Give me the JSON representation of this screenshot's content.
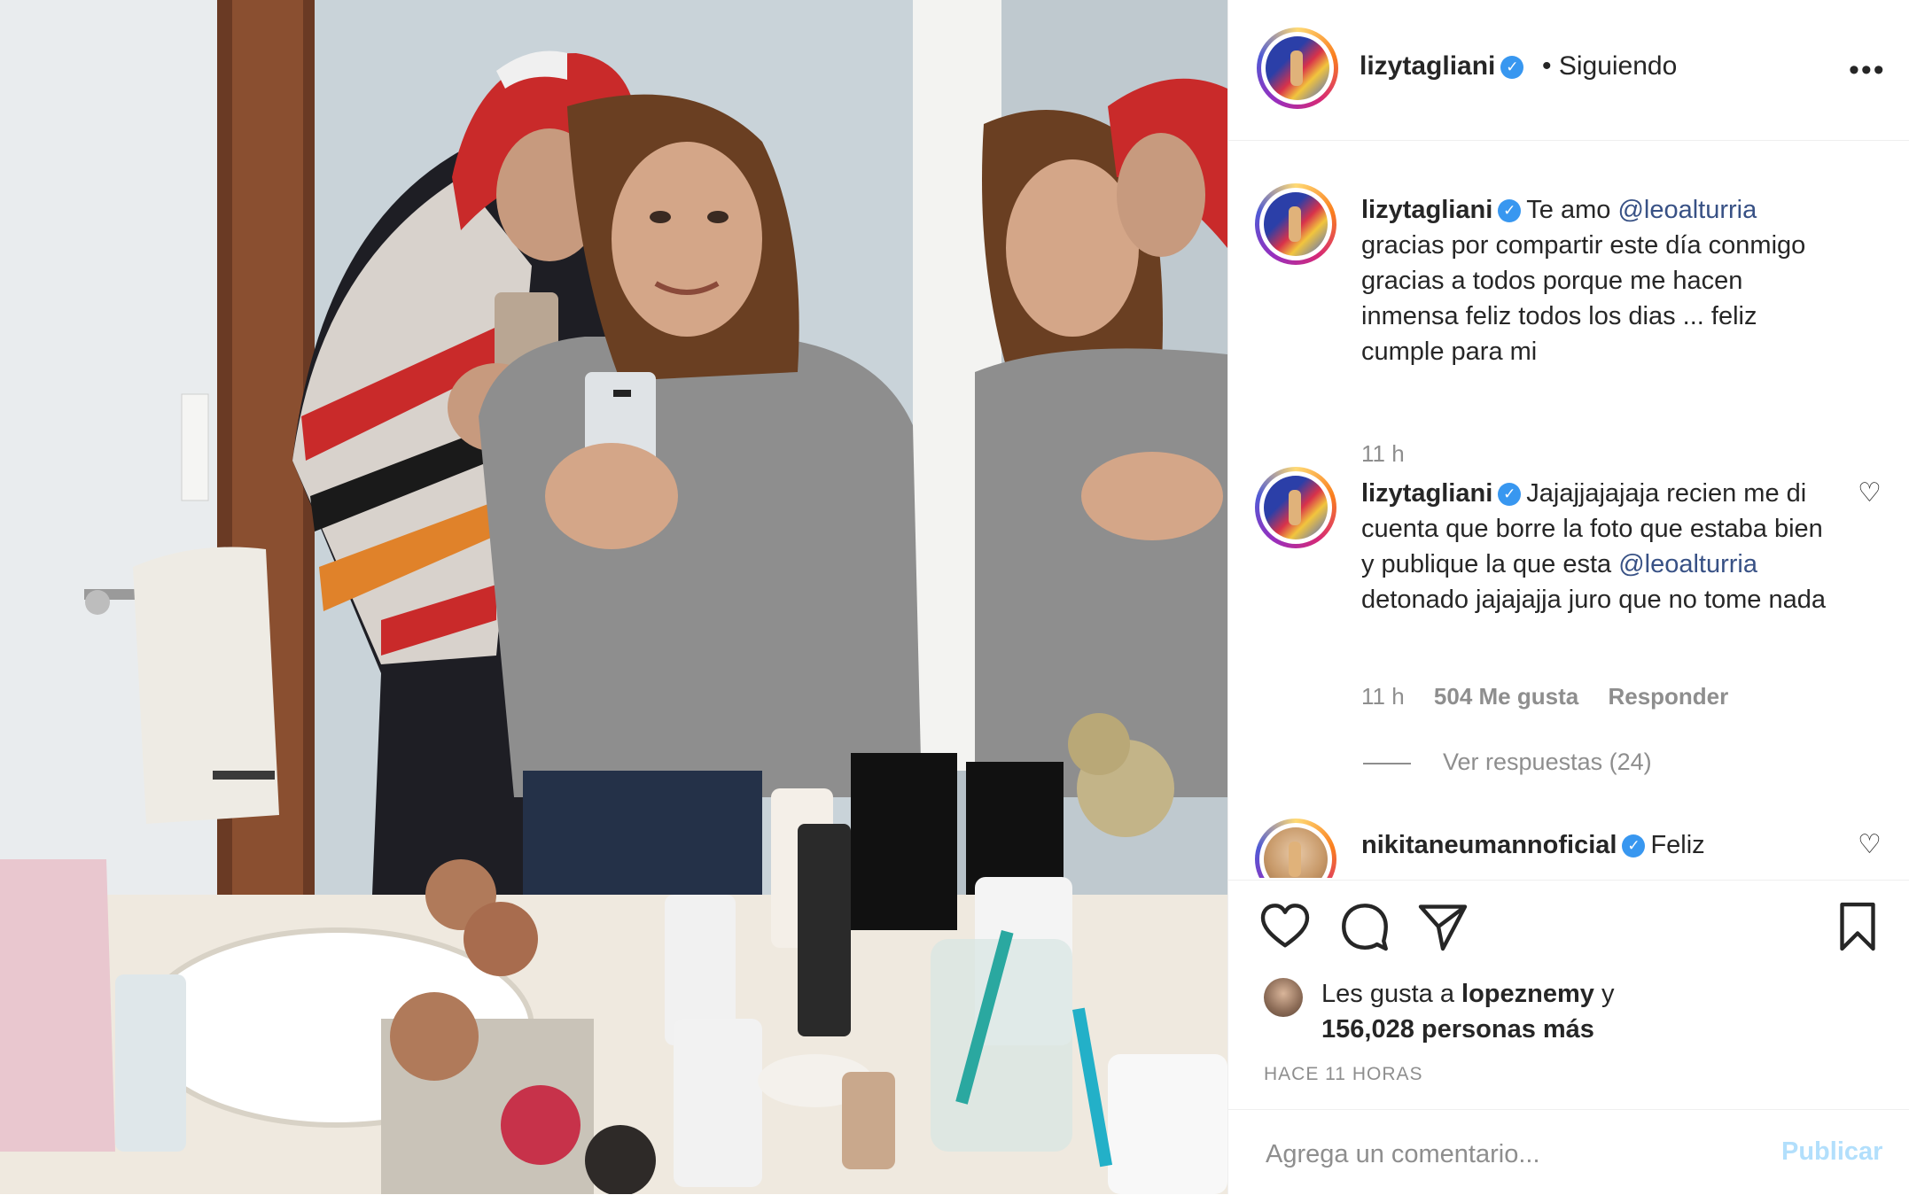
{
  "post": {
    "author": "lizytagliani",
    "follow_status": "• Siguiendo",
    "more_label": "•••"
  },
  "comments": [
    {
      "user": "lizytagliani",
      "text_pre": "Te amo ",
      "mention": "@leoalturria",
      "text_post": " gracias por compartir este día conmigo gracias a todos porque me hacen inmensa feliz todos los dias ... feliz cumple para mi",
      "time": "11 h"
    },
    {
      "user": "lizytagliani",
      "text_pre": "Jajajjajajaja recien me di cuenta que borre la foto que estaba bien y publique la que esta ",
      "mention": "@leoalturria",
      "text_post": " detonado jajajajja juro que no tome nada",
      "time": "11 h",
      "likes": "504 Me gusta",
      "reply": "Responder",
      "view_replies": "Ver respuestas (24)"
    },
    {
      "user": "nikitaneumannoficial",
      "text_pre": "Feliz",
      "mention": "",
      "text_post": ""
    }
  ],
  "likes": {
    "prefix": "Les gusta a",
    "user": "lopeznemy",
    "conj": "y",
    "others": "156,028 personas más"
  },
  "time_ago": "HACE 11 HORAS",
  "composer": {
    "placeholder": "Agrega un comentario...",
    "publish": "Publicar"
  },
  "icons": [
    "heart-icon",
    "comment-icon",
    "share-icon",
    "bookmark-icon",
    "verified-badge-icon",
    "more-options-icon"
  ],
  "colors": {
    "verified": "#3897f0",
    "link": "#385185",
    "muted": "#8e8e8e",
    "publish_disabled": "#b2dffc"
  }
}
